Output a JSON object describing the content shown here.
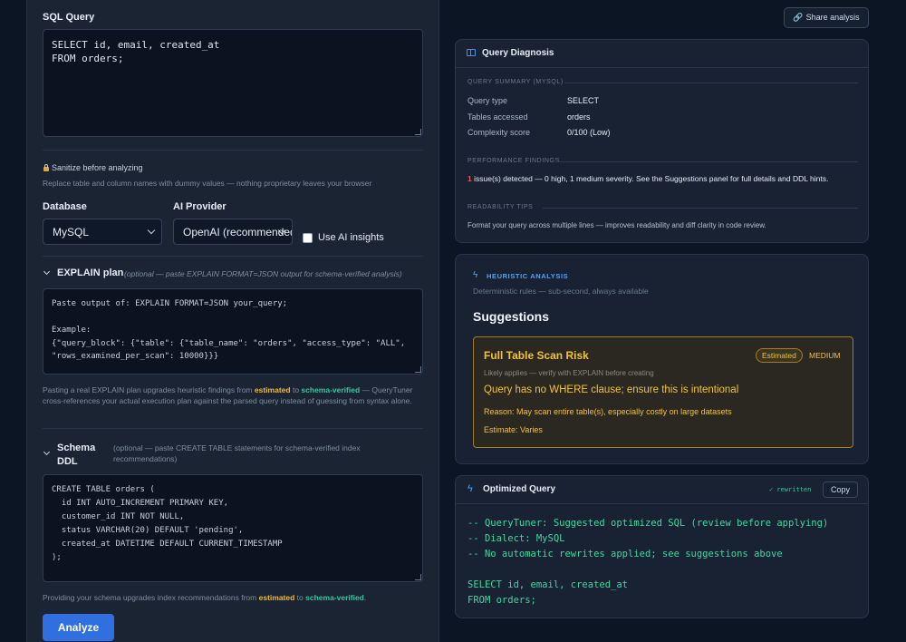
{
  "sql_query": {
    "label": "SQL Query",
    "value": "SELECT id, email, created_at\nFROM orders;"
  },
  "sanitize": {
    "label": "Sanitize before analyzing",
    "description": "Replace table and column names with dummy values — nothing proprietary leaves your browser"
  },
  "database": {
    "label": "Database",
    "selected": "MySQL"
  },
  "ai_provider": {
    "label": "AI Provider",
    "selected": "OpenAI (recommended)"
  },
  "ai_insights": {
    "label": "Use AI insights",
    "checked": false
  },
  "explain": {
    "title": "EXPLAIN plan",
    "hint": "(optional — paste EXPLAIN FORMAT=JSON output for schema-verified analysis)",
    "placeholder": "Paste output of: EXPLAIN FORMAT=JSON your_query;\n\nExample:\n{\"query_block\": {\"table\": {\"table_name\": \"orders\", \"access_type\": \"ALL\",\n\"rows_examined_per_scan\": 10000}}}",
    "note_prefix": "Pasting a real EXPLAIN plan upgrades heuristic findings from",
    "note_estimated": "estimated",
    "note_to": "to",
    "note_verified": "schema-verified",
    "note_suffix": "— QueryTuner cross-references your actual execution plan against the parsed query instead of guessing from syntax alone."
  },
  "schema": {
    "title_line1": "Schema",
    "title_line2": "DDL",
    "hint": "(optional — paste CREATE TABLE statements for schema-verified index recommendations)",
    "value": "CREATE TABLE orders (\n  id INT AUTO_INCREMENT PRIMARY KEY,\n  customer_id INT NOT NULL,\n  status VARCHAR(20) DEFAULT 'pending',\n  created_at DATETIME DEFAULT CURRENT_TIMESTAMP\n);",
    "note_prefix": "Providing your schema upgrades index recommendations from",
    "note_estimated": "estimated",
    "note_to": "to",
    "note_verified": "schema-verified",
    "note_end": "."
  },
  "analyze_button": "Analyze",
  "share_button": "Share analysis",
  "diagnosis": {
    "title": "Query Diagnosis",
    "summary_title": "QUERY SUMMARY (MYSQL)",
    "rows": [
      {
        "key": "Query type",
        "value": "SELECT"
      },
      {
        "key": "Tables accessed",
        "value": "orders"
      },
      {
        "key": "Complexity score",
        "value": "0/100 (Low)"
      }
    ],
    "perf_title": "PERFORMANCE FINDINGS",
    "perf_count": "1",
    "perf_text": "issue(s) detected — 0 high, 1 medium severity. See the Suggestions panel for full details and DDL hints.",
    "read_title": "READABILITY TIPS",
    "read_text": "Format your query across multiple lines — improves readability and diff clarity in code review."
  },
  "heuristic": {
    "badge": "HEURISTIC ANALYSIS",
    "subtitle": "Deterministic rules — sub-second, always available",
    "heading": "Suggestions",
    "suggestion": {
      "title": "Full Table Scan Risk",
      "tag": "Estimated",
      "severity": "MEDIUM",
      "applies": "Likely applies — verify with EXPLAIN before creating",
      "message": "Query has no WHERE clause; ensure this is intentional",
      "reason": "Reason: May scan entire table(s), especially costly on large datasets",
      "estimate": "Estimate: Varies"
    }
  },
  "optimized": {
    "title": "Optimized Query",
    "status": "✓ rewritten",
    "copy": "Copy",
    "code": "-- QueryTuner: Suggested optimized SQL (review before applying)\n-- Dialect: MySQL\n-- No automatic rewrites applied; see suggestions above\n\nSELECT id, email, created_at\nFROM orders;"
  },
  "colors": {
    "accent_blue": "#2f6fe0",
    "estimated_yellow": "#f3b935",
    "verified_teal": "#38c6a0",
    "code_green": "#3fd9a0",
    "suggestion_border": "#a57d22"
  }
}
